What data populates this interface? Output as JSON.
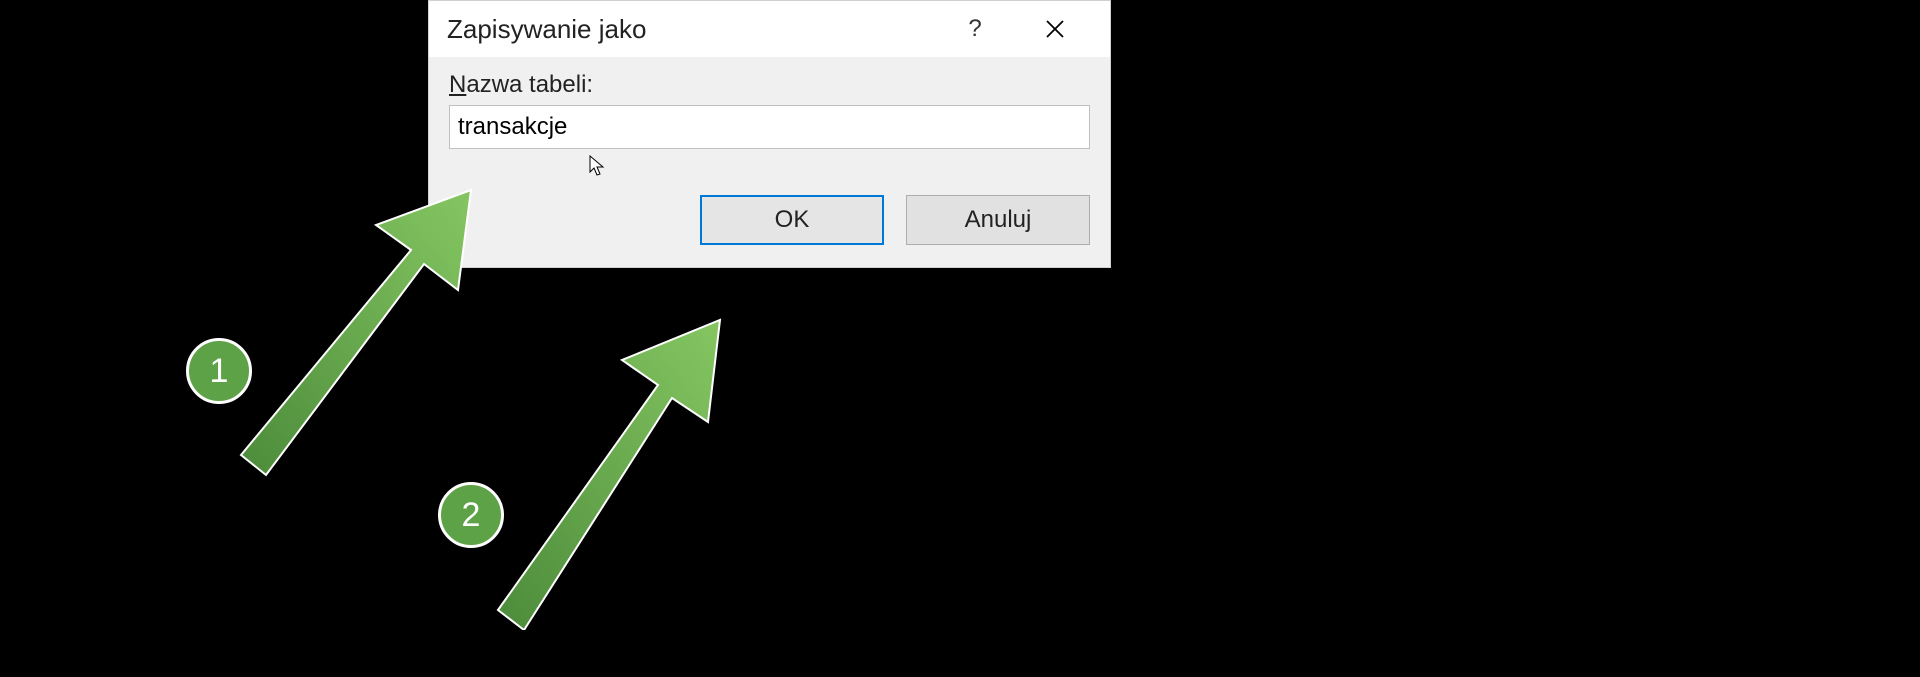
{
  "dialog": {
    "title": "Zapisywanie jako",
    "field_label": "Nazwa tabeli:",
    "field_value": "transakcje",
    "ok_label": "OK",
    "cancel_label": "Anuluj"
  },
  "annotations": {
    "badges": [
      "1",
      "2"
    ]
  }
}
